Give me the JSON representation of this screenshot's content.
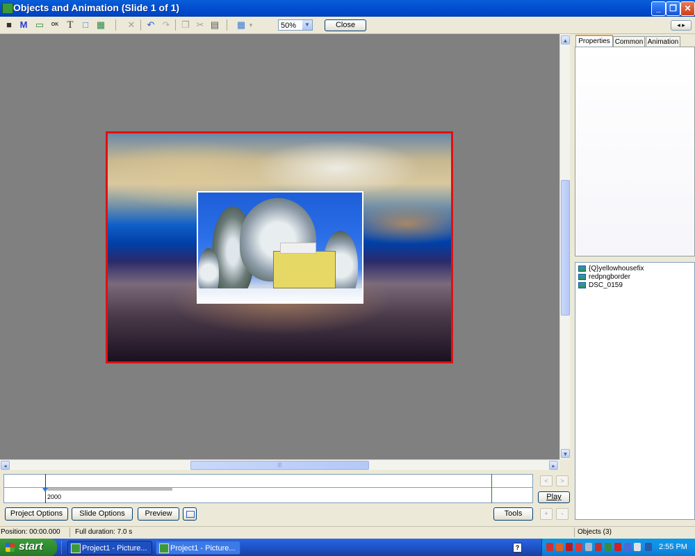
{
  "window": {
    "title": "Objects and Animation  (Slide 1 of 1)",
    "minimize_glyph": "_",
    "restore_glyph": "❐",
    "close_glyph": "✕"
  },
  "toolbar": {
    "icons": [
      "camera-icon",
      "mask-icon",
      "frame-icon",
      "button-icon",
      "text-icon",
      "rectangle-icon",
      "image-icon",
      "delete-icon",
      "undo-icon",
      "redo-icon",
      "copy-icon",
      "cut-icon",
      "paste-icon",
      "grid-icon"
    ],
    "glyphs": {
      "camera": "■",
      "mask": "M",
      "frame": "▭",
      "button": "OK",
      "text": "T",
      "rectangle": "□",
      "image": "▦",
      "delete": "✕",
      "undo": "↶",
      "redo": "↷",
      "copy": "❐",
      "cut": "✂",
      "paste": "▤",
      "grid": "▦",
      "grid_arrow": "▾"
    },
    "zoom_value": "50%",
    "zoom_arrow": "▼",
    "close_label": "Close",
    "nav_left": "◂",
    "nav_right": "▸"
  },
  "scrollbars": {
    "up": "▲",
    "down": "▼",
    "left": "◂",
    "right": "▸",
    "grip": "|||"
  },
  "timeline": {
    "marker_label": "2000",
    "prev_glyph": "<",
    "next_glyph": ">",
    "play_label": "Play"
  },
  "bottom_buttons": {
    "project_options": "Project Options",
    "slide_options": "Slide Options",
    "preview": "Preview",
    "tools": "Tools",
    "plus": "+",
    "minus": "-"
  },
  "right_panel": {
    "tabs": [
      {
        "label": "Properties",
        "active": true
      },
      {
        "label": "Common",
        "active": false
      },
      {
        "label": "Animation",
        "active": false
      }
    ],
    "objects": [
      {
        "name": "{Q}yellowhousefix"
      },
      {
        "name": "redpngborder"
      },
      {
        "name": "DSC_0159"
      }
    ]
  },
  "status": {
    "position": "Position:  00:00.000",
    "duration": "Full duration:  7.0 s",
    "objects_count": "Objects (3)"
  },
  "taskbar": {
    "start_label": "start",
    "items": [
      "Project1 - Picture...",
      "Project1 - Picture..."
    ],
    "clock": "2:55 PM"
  },
  "colors": {
    "slide_border": "#e01010",
    "canvas_bg": "#808080",
    "titlebar": "#0350d0",
    "taskbar": "#245edc",
    "start": "#3c9a3c"
  }
}
